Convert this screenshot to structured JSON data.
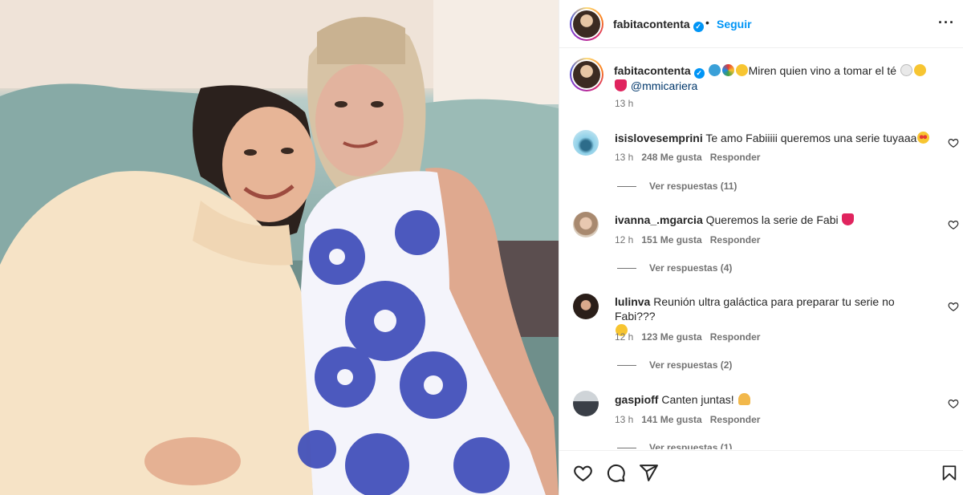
{
  "post": {
    "username": "fabitacontenta",
    "verified_mark": "✓",
    "dot": "•",
    "follow_label": "Seguir",
    "more_label": "···",
    "caption": "Miren quien vino a tomar el té",
    "caption_mention": "@mmicariera",
    "caption_time": "13 h",
    "caption_icons": [
      "dolphin-emoji",
      "rainbow-emoji",
      "smile-emoji",
      "teacup-emoji",
      "sweat-emoji",
      "heart-emoji"
    ]
  },
  "comments": [
    {
      "username": "isislovesemprini",
      "text": "Te amo Fabiiiii queremos una serie tuyaaa",
      "emoji": "heart-eyes-emoji",
      "time": "13 h",
      "likes": "248 Me gusta",
      "reply_label": "Responder",
      "replies_label": "Ver respuestas (11)"
    },
    {
      "username": "ivanna_.mgarcia",
      "text": "Queremos la serie de Fabi",
      "emoji": "red-heart-emoji",
      "time": "12 h",
      "likes": "151 Me gusta",
      "reply_label": "Responder",
      "replies_label": "Ver respuestas (4)"
    },
    {
      "username": "lulinva",
      "text": "Reunión ultra galáctica para preparar tu serie no Fabi???",
      "emoji": "grin-emoji",
      "time": "12 h",
      "likes": "123 Me gusta",
      "reply_label": "Responder",
      "replies_label": "Ver respuestas (2)"
    },
    {
      "username": "gaspioff",
      "text": "Canten juntas!",
      "emoji": "praying-hands-emoji",
      "time": "13 h",
      "likes": "141 Me gusta",
      "reply_label": "Responder",
      "replies_label": "Ver respuestas (1)"
    }
  ],
  "colors": {
    "link_blue": "#0095f6",
    "mention_blue": "#00376b",
    "meta_gray": "#737373",
    "divider": "#efefef"
  },
  "icons": [
    "heart-icon",
    "comment-icon",
    "share-icon",
    "bookmark-icon",
    "more-icon",
    "verified-icon"
  ]
}
